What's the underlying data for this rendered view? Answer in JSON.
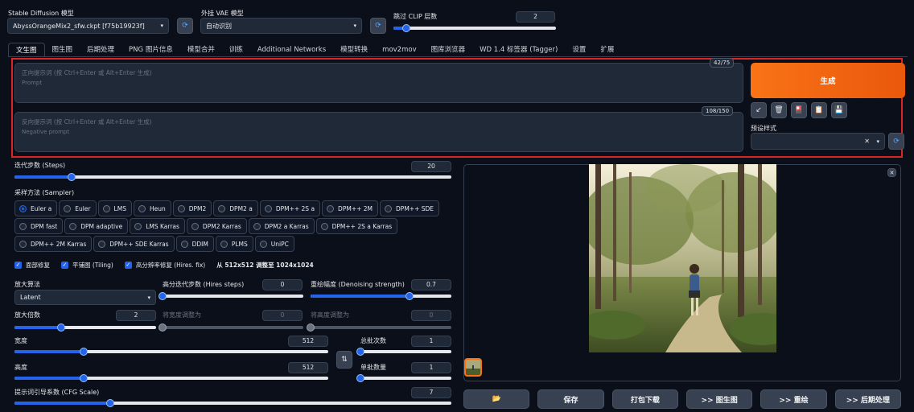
{
  "top": {
    "sd_model": {
      "label": "Stable Diffusion 模型",
      "value": "AbyssOrangeMix2_sfw.ckpt [f75b19923f]"
    },
    "vae": {
      "label": "外挂 VAE 模型",
      "value": "自动识别"
    },
    "clip_skip": {
      "label": "跳过 CLIP 层数",
      "value": "2",
      "fraction": 0.08
    }
  },
  "tabs": [
    "文生图",
    "图生图",
    "后期处理",
    "PNG 图片信息",
    "模型合并",
    "训练",
    "Additional Networks",
    "模型转换",
    "mov2mov",
    "图库浏览器",
    "WD 1.4 标签器 (Tagger)",
    "设置",
    "扩展"
  ],
  "prompt": {
    "placeholder": "正向提示词 (按 Ctrl+Enter 或 Alt+Enter 生成)",
    "sub": "Prompt",
    "token_count": "42/75"
  },
  "negative": {
    "placeholder": "反向提示词 (按 Ctrl+Enter 或 Alt+Enter 生成)",
    "sub": "Negative prompt",
    "token_count": "108/150"
  },
  "generate_label": "生成",
  "styles_label": "预设样式",
  "accent": "#ea580c",
  "steps": {
    "label": "迭代步数 (Steps)",
    "value": "20",
    "fraction": 0.13
  },
  "sampler": {
    "label": "采样方法 (Sampler)",
    "selected": "Euler a",
    "rows": [
      [
        "Euler a",
        "Euler",
        "LMS",
        "Heun",
        "DPM2",
        "DPM2 a",
        "DPM++ 2S a",
        "DPM++ 2M",
        "DPM++ SDE"
      ],
      [
        "DPM fast",
        "DPM adaptive",
        "LMS Karras",
        "DPM2 Karras",
        "DPM2 a Karras",
        "DPM++ 2S a Karras"
      ],
      [
        "DPM++ 2M Karras",
        "DPM++ SDE Karras",
        "DDIM",
        "PLMS",
        "UniPC"
      ]
    ]
  },
  "checks": {
    "face_restore": "面部修复",
    "tiling": "平铺图 (Tiling)",
    "hires": "高分辨率修复 (Hires. fix)",
    "hires_info": "从 512x512 调整至 1024x1024"
  },
  "hires": {
    "upscaler_label": "放大算法",
    "upscaler_value": "Latent",
    "hires_steps": {
      "label": "高分迭代步数 (Hires steps)",
      "value": "0",
      "fraction": 0.0
    },
    "denoise": {
      "label": "重绘幅度 (Denoising strength)",
      "value": "0.7",
      "fraction": 0.7
    },
    "upscale_by": {
      "label": "放大倍数",
      "value": "2",
      "fraction": 0.33
    },
    "resize_w": {
      "label": "将宽度调整为",
      "value": "0",
      "fraction": 0.0
    },
    "resize_h": {
      "label": "将高度调整为",
      "value": "0",
      "fraction": 0.0
    }
  },
  "size": {
    "width": {
      "label": "宽度",
      "value": "512",
      "fraction": 0.22
    },
    "height": {
      "label": "高度",
      "value": "512",
      "fraction": 0.22
    },
    "batch_count": {
      "label": "总批次数",
      "value": "1",
      "fraction": 0.0
    },
    "batch_size": {
      "label": "单批数量",
      "value": "1",
      "fraction": 0.0
    }
  },
  "cfg": {
    "label": "提示词引导系数 (CFG Scale)",
    "value": "7",
    "fraction": 0.22
  },
  "actions": [
    "📂",
    "保存",
    "打包下载",
    ">> 图生图",
    ">> 重绘",
    ">> 后期处理"
  ]
}
